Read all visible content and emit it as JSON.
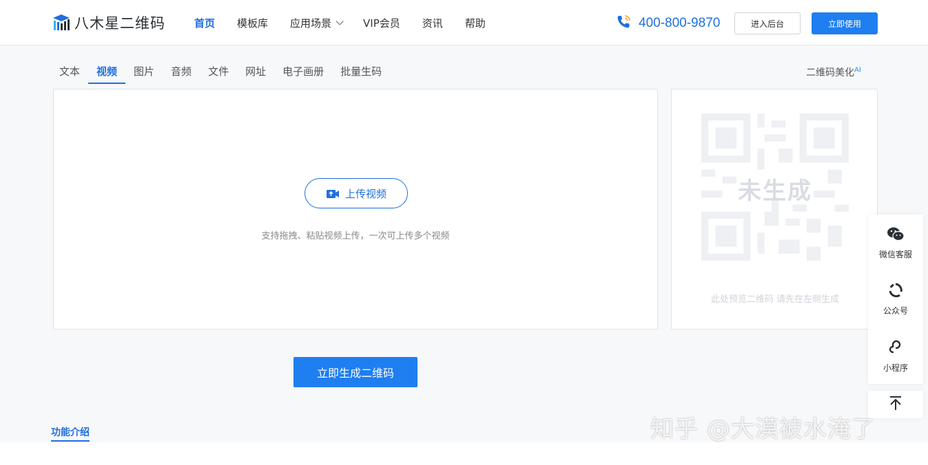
{
  "header": {
    "logo_text": "八木星二维码",
    "nav": [
      {
        "label": "首页",
        "active": true
      },
      {
        "label": "模板库"
      },
      {
        "label": "应用场景",
        "dropdown": true
      },
      {
        "label": "VIP会员"
      },
      {
        "label": "资讯"
      },
      {
        "label": "帮助"
      }
    ],
    "phone": "400-800-9870",
    "admin_button": "进入后台",
    "use_button": "立即使用"
  },
  "tabs": [
    {
      "label": "文本"
    },
    {
      "label": "视频",
      "active": true
    },
    {
      "label": "图片"
    },
    {
      "label": "音频"
    },
    {
      "label": "文件"
    },
    {
      "label": "网址"
    },
    {
      "label": "电子画册"
    },
    {
      "label": "批量生码"
    }
  ],
  "beautify": {
    "label": "二维码美化",
    "badge": "AI"
  },
  "upload": {
    "button_label": "上传视频",
    "hint": "支持拖拽、粘贴视频上传，一次可上传多个视频"
  },
  "preview": {
    "status": "未生成",
    "hint": "此处预览二维码 请先在左侧生成"
  },
  "generate_button": "立即生成二维码",
  "feature_tab": "功能介绍",
  "float": {
    "items": [
      {
        "label": "微信客服",
        "icon": "wechat-icon"
      },
      {
        "label": "公众号",
        "icon": "official-account-icon"
      },
      {
        "label": "小程序",
        "icon": "mini-program-icon"
      }
    ],
    "back_top_icon": "arrow-up-icon"
  },
  "watermark": "知乎 @大漠被水淹了",
  "colors": {
    "primary": "#1f7ef0",
    "link": "#1f6fde"
  }
}
